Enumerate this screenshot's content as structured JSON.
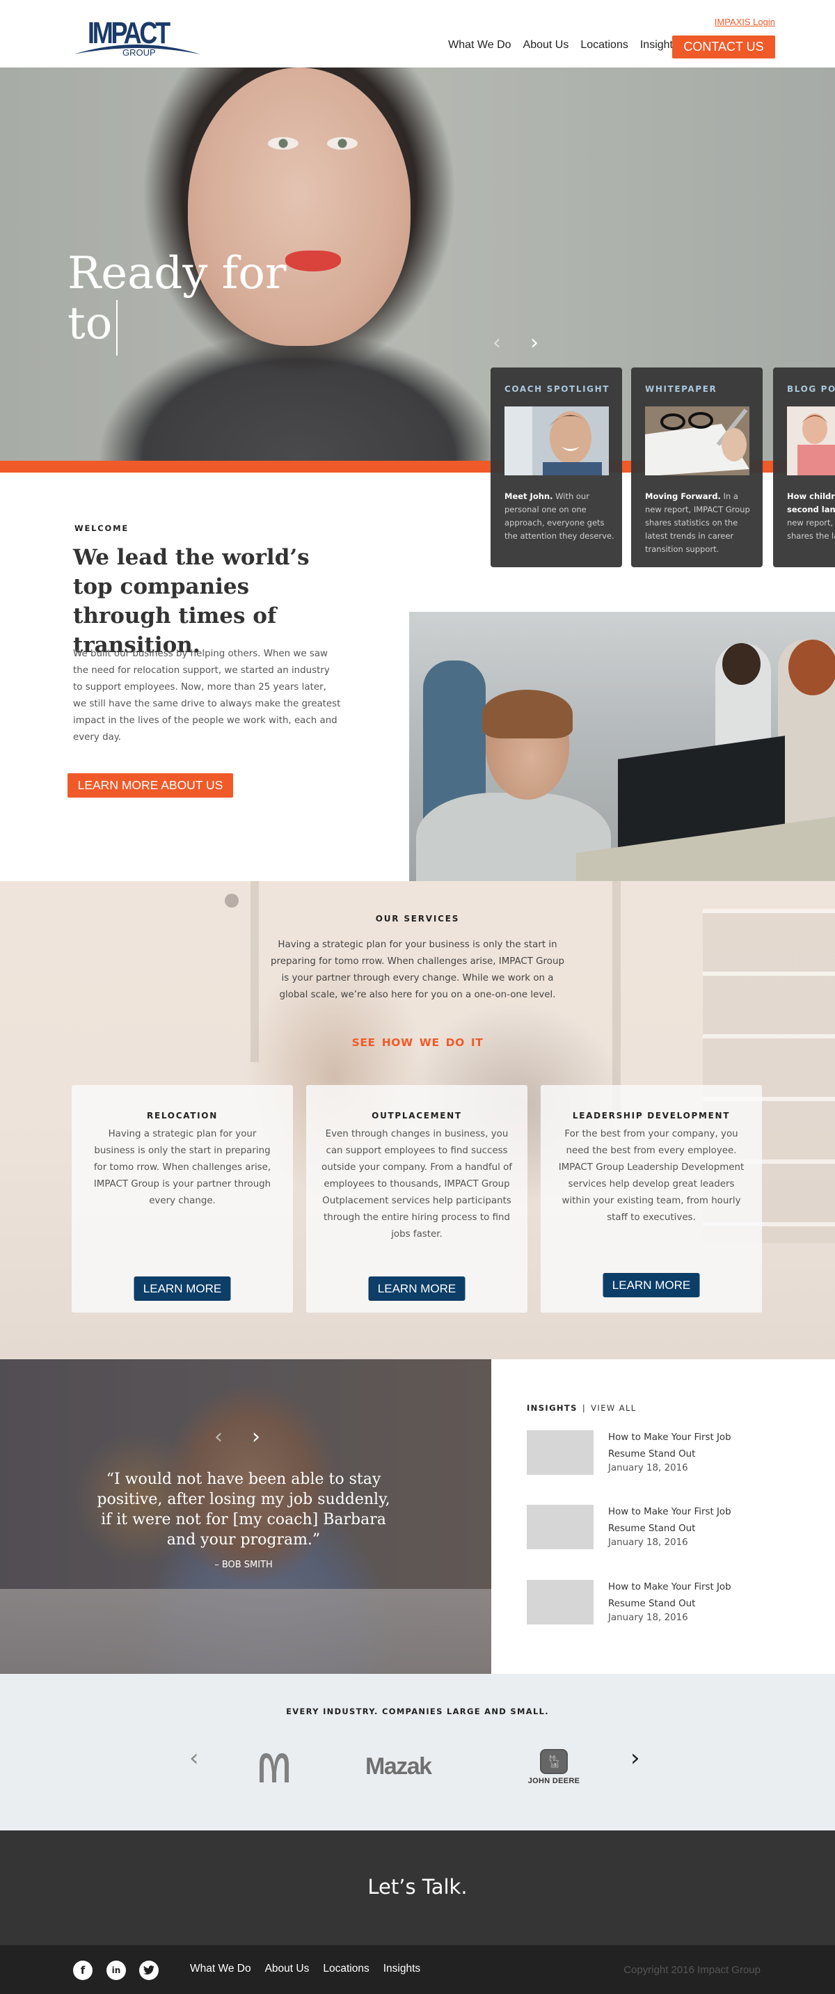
{
  "header": {
    "logo_text": "IMPACT",
    "logo_subtext": "GROUP",
    "login_link": "IMPAXIS Login",
    "nav": [
      {
        "label": "What We Do"
      },
      {
        "label": "About Us"
      },
      {
        "label": "Locations"
      },
      {
        "label": "Insights"
      }
    ],
    "contact_label": "CONTACT US"
  },
  "hero": {
    "headline_line1": "Ready for",
    "headline_line2": "to",
    "prev_icon": "chevron-left",
    "next_icon": "chevron-right",
    "cards": [
      {
        "label": "COACH SPOTLIGHT",
        "bold": "Meet John.",
        "text": " With our personal one on one approach, everyone gets the attention they deserve.",
        "image": "smiling-man-photo"
      },
      {
        "label": "WHITEPAPER",
        "bold": "Moving Forward.",
        "text": " In a new report, IMPACT Group shares statistics on the latest trends in career transition support.",
        "image": "glasses-and-pen-photo"
      },
      {
        "label": "BLOG POST",
        "bold": "How children learn a second language.",
        "text": " In a new report, IMPACT Group shares the latest trends",
        "image": "children-photo"
      }
    ]
  },
  "welcome": {
    "label": "WELCOME",
    "title": "We lead the world’s top companies through times of transition.",
    "body": "We built our business by helping others. When we saw the need for relocation support, we started an industry to support employees. Now, more than 25 years later, we still have the same drive to always make the greatest impact in the lives of the people we work with, each and every day.",
    "button": "LEARN MORE ABOUT US"
  },
  "services": {
    "label": "OUR SERVICES",
    "intro": "Having a strategic plan for your business is only the start in preparing for tomo rrow. When challenges arise, IMPACT Group is your partner through every change. While we work on a global scale, we’re also here for you on a one-on-one level.",
    "cta": "SEE  HOW WE DO IT",
    "cards": [
      {
        "title": "RELOCATION",
        "text": "Having a strategic plan for your business is only the start in preparing for tomo rrow. When challenges arise, IMPACT Group is your partner through every change.",
        "button": "LEARN MORE"
      },
      {
        "title": "OUTPLACEMENT",
        "text": "Even through changes in business, you can support employees to find success outside your company. From a handful of employees to thousands, IMPACT Group Outplacement services help participants through the entire hiring process to find jobs faster.",
        "button": "LEARN MORE"
      },
      {
        "title": "LEADERSHIP DEVELOPMENT",
        "text": "For the best from your company, you need the best from every employee. IMPACT Group Leadership Development services help develop great leaders within your existing team, from hourly staff to executives.",
        "button": "LEARN MORE"
      }
    ]
  },
  "testimonial": {
    "quote": "“I would not have been able to stay positive, after losing my job suddenly, if it were not for [my coach] Barbara and your program.”",
    "author": "– BOB SMITH"
  },
  "insights": {
    "label": "INSIGHTS",
    "separator": "|",
    "view_all": "VIEW ALL",
    "items": [
      {
        "title": "How to Make Your First Job Resume Stand Out",
        "date": "January 18, 2016"
      },
      {
        "title": "How to Make Your First Job Resume Stand Out",
        "date": "January 18, 2016"
      },
      {
        "title": "How to Make Your First Job Resume Stand Out",
        "date": "January 18, 2016"
      }
    ]
  },
  "clients": {
    "label": "EVERY INDUSTRY. COMPANIES LARGE AND SMALL.",
    "logos": [
      {
        "name": "McDonald's"
      },
      {
        "name": "Mazak"
      },
      {
        "name": "JOHN DEERE"
      }
    ]
  },
  "talk": {
    "text": "Let’s Talk."
  },
  "footer": {
    "social": [
      {
        "icon": "facebook",
        "glyph": "f"
      },
      {
        "icon": "linkedin",
        "glyph": "in"
      },
      {
        "icon": "twitter",
        "glyph": "t"
      }
    ],
    "nav": [
      {
        "label": "What We Do"
      },
      {
        "label": "About Us"
      },
      {
        "label": "Locations"
      },
      {
        "label": "Insights"
      }
    ],
    "copyright": "Copyright 2016 Impact Group"
  },
  "colors": {
    "accent": "#f05a28",
    "navy": "#0c3e68",
    "logo_blue": "#1b3a68",
    "card_label": "#a9c7dc",
    "dark": "#353535",
    "footer": "#222222"
  }
}
